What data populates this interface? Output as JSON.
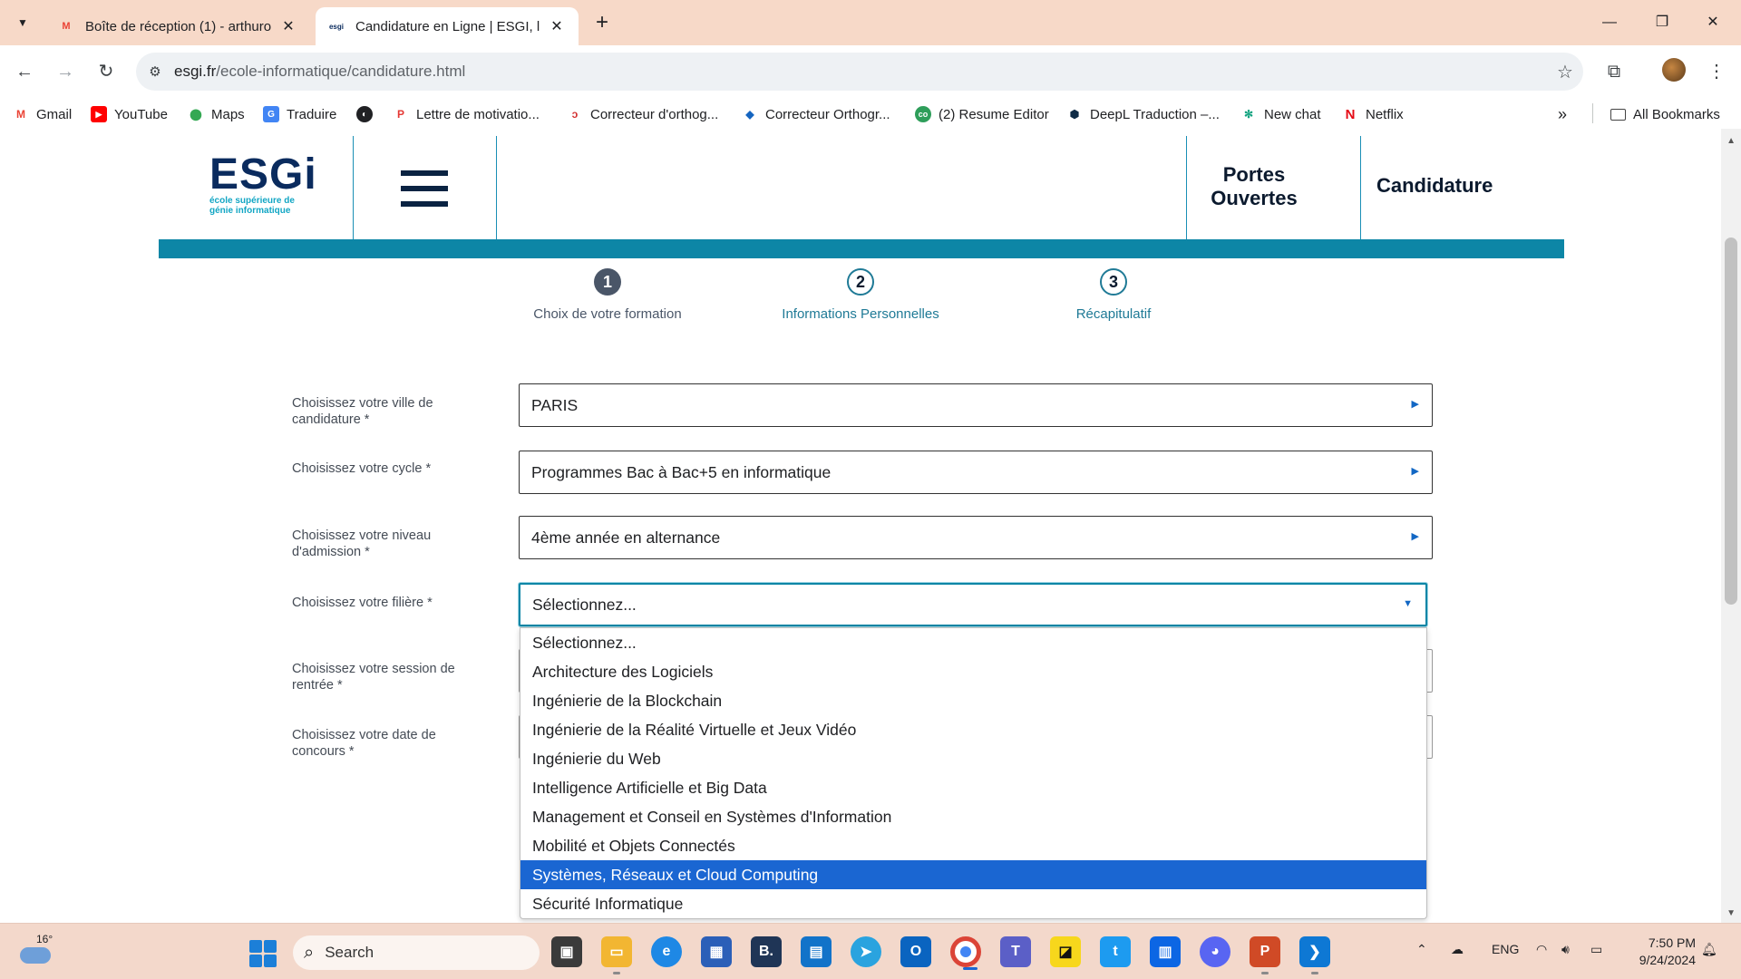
{
  "browser": {
    "tabs": [
      {
        "title": "Boîte de réception (1) - arthuro",
        "favicon": "gmail-icon",
        "active": false
      },
      {
        "title": "Candidature en Ligne | ESGI, l'É",
        "favicon": "esgi-icon",
        "active": true
      }
    ],
    "new_tab": "+",
    "url_domain": "esgi.fr",
    "url_path": "/ecole-informatique/candidature.html",
    "bookmarks": [
      {
        "label": "Gmail",
        "icon": "gmail-icon"
      },
      {
        "label": "YouTube",
        "icon": "youtube-icon"
      },
      {
        "label": "Maps",
        "icon": "maps-icon"
      },
      {
        "label": "Traduire",
        "icon": "translate-icon"
      },
      {
        "label": "",
        "icon": "globe-icon"
      },
      {
        "label": "Lettre de motivatio...",
        "icon": "document-icon"
      },
      {
        "label": "Correcteur d'orthog...",
        "icon": "spellcheck-icon"
      },
      {
        "label": "Correcteur Orthogr...",
        "icon": "spellcheck-icon"
      },
      {
        "label": "(2) Resume Editor",
        "icon": "resume-icon"
      },
      {
        "label": "DeepL Traduction –...",
        "icon": "deepl-icon"
      },
      {
        "label": "New chat",
        "icon": "chatgpt-icon"
      },
      {
        "label": "Netflix",
        "icon": "netflix-icon"
      }
    ],
    "more_bookmarks": "»",
    "all_bookmarks": "All Bookmarks"
  },
  "site": {
    "logo_text": "ESGi",
    "logo_tagline_1": "école supérieure de",
    "logo_tagline_2": "génie informatique",
    "nav_portes_line1": "Portes",
    "nav_portes_line2": "Ouvertes",
    "nav_candidature": "Candidature"
  },
  "steps": [
    {
      "number": "1",
      "label": "Choix de votre formation",
      "state": "current"
    },
    {
      "number": "2",
      "label": "Informations Personnelles",
      "state": "next"
    },
    {
      "number": "3",
      "label": "Récapitulatif",
      "state": "next"
    }
  ],
  "form": {
    "fields": [
      {
        "label": "Choisissez votre ville de candidature *",
        "value": "PARIS"
      },
      {
        "label": "Choisissez votre cycle *",
        "value": "Programmes Bac à Bac+5 en informatique"
      },
      {
        "label": "Choisissez votre niveau d'admission *",
        "value": "4ème année en alternance"
      },
      {
        "label": "Choisissez votre filière *",
        "value": "Sélectionnez..."
      },
      {
        "label": "Choisissez votre session de rentrée *",
        "value": ""
      },
      {
        "label": "Choisissez votre date de concours *",
        "value": ""
      }
    ],
    "filiere_options": [
      "Sélectionnez...",
      "Architecture des Logiciels",
      "Ingénierie de la Blockchain",
      "Ingénierie de la Réalité Virtuelle et Jeux Vidéo",
      "Ingénierie du Web",
      "Intelligence Artificielle et Big Data",
      "Management et Conseil en Systèmes d'Information",
      "Mobilité et Objets Connectés",
      "Systèmes, Réseaux et Cloud Computing",
      "Sécurité Informatique"
    ],
    "highlighted_option": "Systèmes, Réseaux et Cloud Computing"
  },
  "taskbar": {
    "temperature": "16°",
    "search_placeholder": "Search",
    "language": "ENG",
    "time": "7:50 PM",
    "date": "9/24/2024"
  },
  "colors": {
    "tabbar": "#f7d9c8",
    "esgi_blue": "#0d86a6",
    "highlight": "#1a66d2",
    "candidature_underline": "#ffe100"
  }
}
